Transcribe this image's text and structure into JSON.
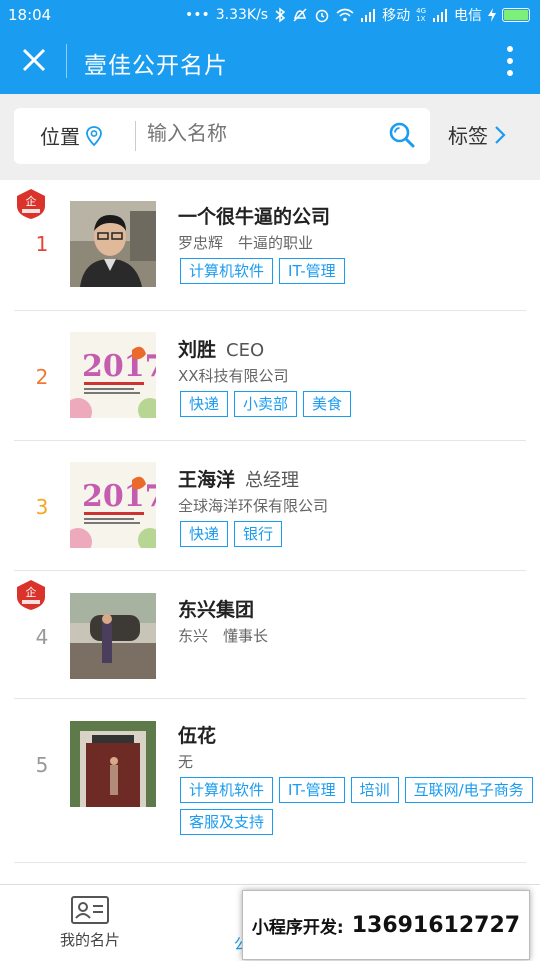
{
  "status_bar": {
    "time": "18:04",
    "net_speed": "3.33K/s",
    "carrier1": "移动",
    "carrier2": "电信",
    "signal_labels": [
      "4G",
      "1X"
    ]
  },
  "titlebar": {
    "title": "壹佳公开名片",
    "close_icon": "close-icon",
    "more_icon": "more-vertical-icon"
  },
  "search": {
    "location_label": "位置",
    "placeholder": "输入名称",
    "tag_label": "标签"
  },
  "cards": [
    {
      "rank": "1",
      "rank_color": "#e8423a",
      "name": "一个很牛逼的公司",
      "position": "",
      "subtitle": "罗忠辉　牛逼的职业",
      "tags": [
        "计算机软件",
        "IT-管理"
      ],
      "badge": true
    },
    {
      "rank": "2",
      "rank_color": "#f07a32",
      "name": "刘胜",
      "position": "CEO",
      "subtitle": "XX科技有限公司",
      "tags": [
        "快递",
        "小卖部",
        "美食"
      ],
      "badge": false
    },
    {
      "rank": "3",
      "rank_color": "#f5a623",
      "name": "王海洋",
      "position": "总经理",
      "subtitle": "全球海洋环保有限公司",
      "tags": [
        "快递",
        "银行"
      ],
      "badge": false
    },
    {
      "rank": "4",
      "rank_color": "#999999",
      "name": "东兴集团",
      "position": "",
      "subtitle": "东兴　懂事长",
      "tags": [],
      "badge": true
    },
    {
      "rank": "5",
      "rank_color": "#999999",
      "name": "伍花",
      "position": "",
      "subtitle": "无",
      "tags": [
        "计算机软件",
        "IT-管理",
        "培训",
        "互联网/电子商务",
        "客服及支持"
      ],
      "badge": false
    }
  ],
  "bottom_nav": {
    "my_card_label": "我的名片",
    "second_label": "公"
  },
  "promo": {
    "label": "小程序开发:",
    "phone": "13691612727"
  },
  "colors": {
    "accent": "#1a9cf0",
    "badge_red": "#d9332c"
  }
}
